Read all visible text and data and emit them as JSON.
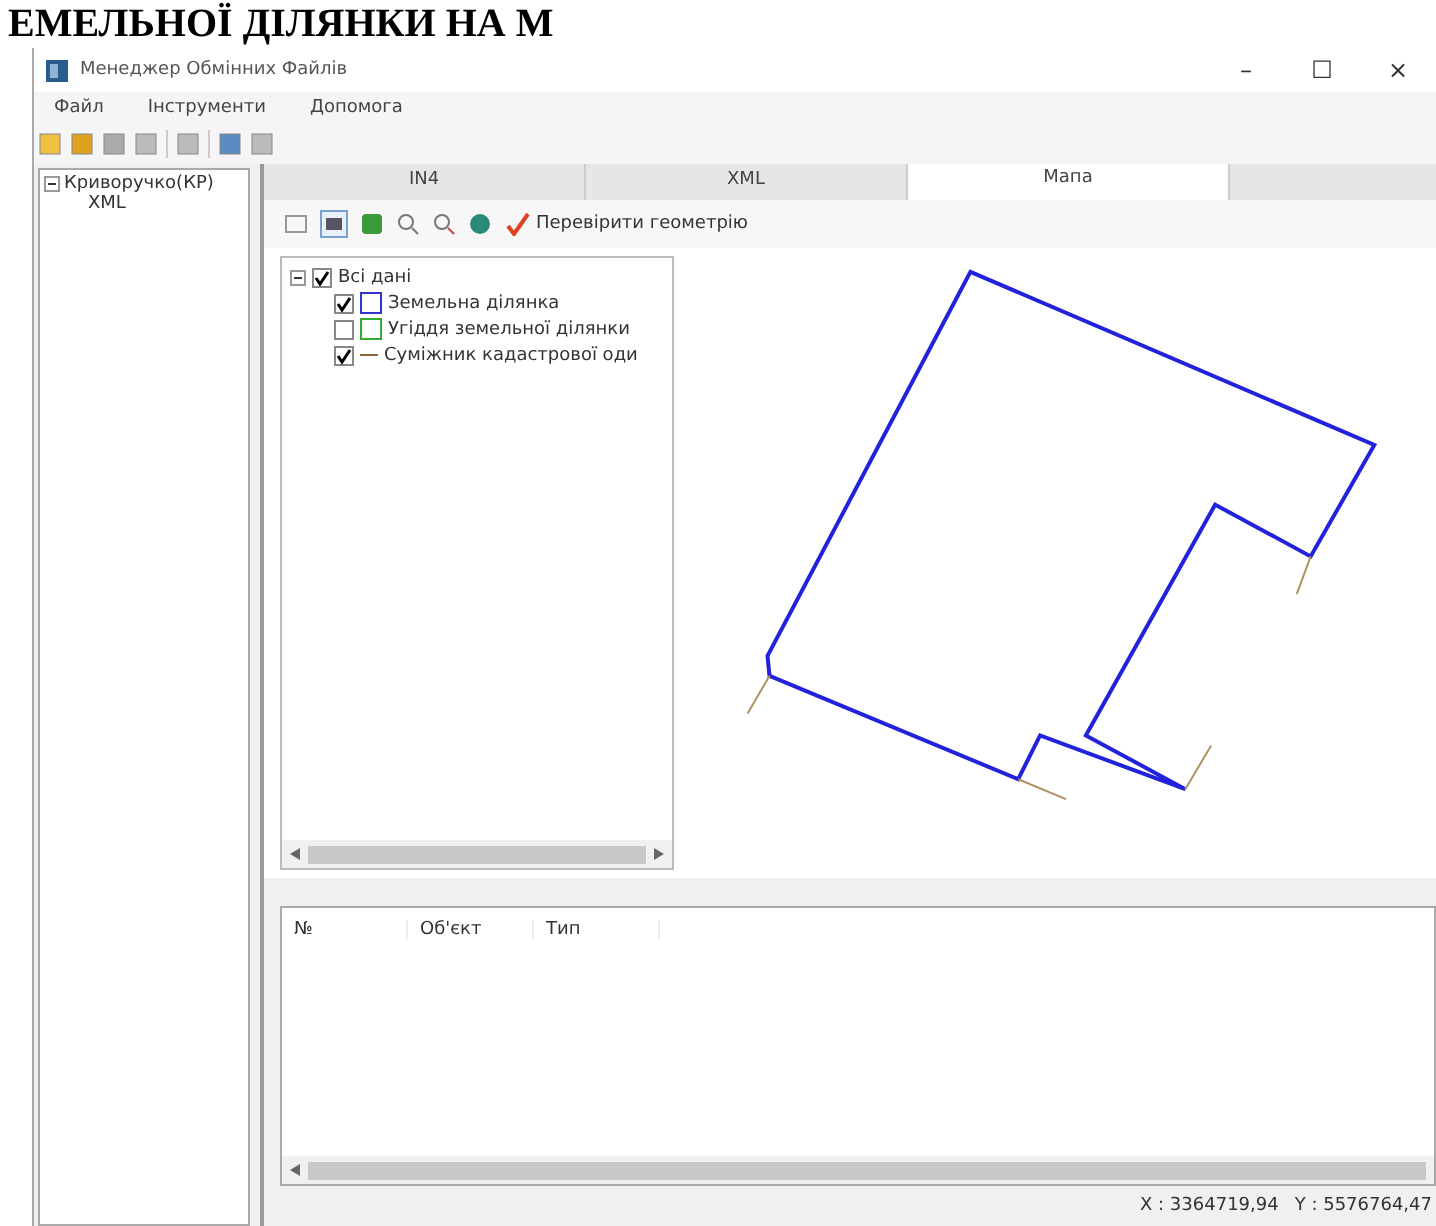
{
  "page_heading": "ЕМЕЛЬНОЇ ДІЛЯНКИ НА М",
  "window": {
    "title": "Менеджер Обмінних Файлів",
    "controls": [
      "–",
      "☐",
      "×"
    ]
  },
  "menu": [
    "Файл",
    "Інструменти",
    "Допомога"
  ],
  "file_tree": {
    "label": "Криворучко(КР)",
    "expanded": true,
    "children": [
      {
        "label": "XML"
      }
    ]
  },
  "tabs": [
    {
      "label": "IN4",
      "selected": false
    },
    {
      "label": "XML",
      "selected": false
    },
    {
      "label": "Мапа",
      "selected": true
    }
  ],
  "map_toolbar": {
    "check_button": "Перевірити геометрію"
  },
  "layers": {
    "label": "Всі дані",
    "checked": true,
    "expanded": true,
    "children": [
      {
        "label": "Земельна ділянка",
        "checked": true,
        "kind": "square",
        "color": "#3333cc"
      },
      {
        "label": "Угіддя земельної ділянки",
        "checked": false,
        "kind": "square",
        "color": "#33aa33"
      },
      {
        "label": "Суміжник кадастрової оди",
        "checked": true,
        "kind": "line",
        "color": "#8a6a3a"
      }
    ]
  },
  "table": {
    "columns": [
      "№",
      "Об'єкт",
      "Тип"
    ]
  },
  "status_bar": {
    "x": "X : 3364719,94",
    "y": "Y : 5576764,47"
  }
}
